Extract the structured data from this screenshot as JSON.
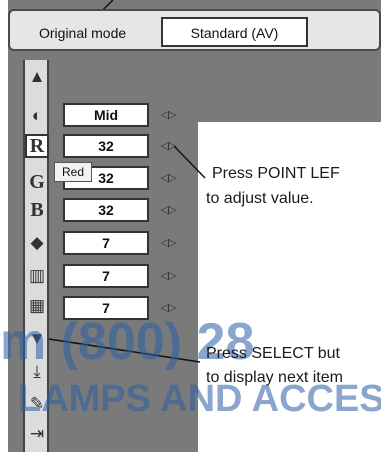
{
  "mode": {
    "label": "Original mode",
    "value": "Standard (AV)"
  },
  "icons": [
    {
      "name": "up-arrow-icon",
      "glyph": "▲"
    },
    {
      "name": "contrast-ball-icon",
      "glyph": "◐"
    },
    {
      "name": "red-r-icon",
      "glyph": "R"
    },
    {
      "name": "green-g-icon",
      "glyph": "G"
    },
    {
      "name": "blue-b-icon",
      "glyph": "B"
    },
    {
      "name": "color-cube-icon",
      "glyph": "◆"
    },
    {
      "name": "bar-graph-icon",
      "glyph": "▥"
    },
    {
      "name": "grid-pattern-icon",
      "glyph": "▦"
    },
    {
      "name": "down-arrow-icon",
      "glyph": "▼"
    },
    {
      "name": "store-icon",
      "glyph": "⤓"
    },
    {
      "name": "reset-icon",
      "glyph": "✎"
    },
    {
      "name": "exit-icon",
      "glyph": "⇥"
    }
  ],
  "values": [
    "Mid",
    "32",
    "32",
    "32",
    "7",
    "7",
    "7"
  ],
  "arrows": "◁▷",
  "tooltip": "Red",
  "callouts": {
    "adjust_line1": "Press POINT LEF",
    "adjust_line2": "to adjust value.",
    "select_line1": "Press SELECT but",
    "select_line2": "to display next item"
  },
  "watermark": {
    "phone": "m (800) 28",
    "brand": "LAMPS AND ACCES"
  },
  "colors": {
    "panel_gray": "#7a7a7a",
    "watermark_blue": "#2b5fa6"
  }
}
